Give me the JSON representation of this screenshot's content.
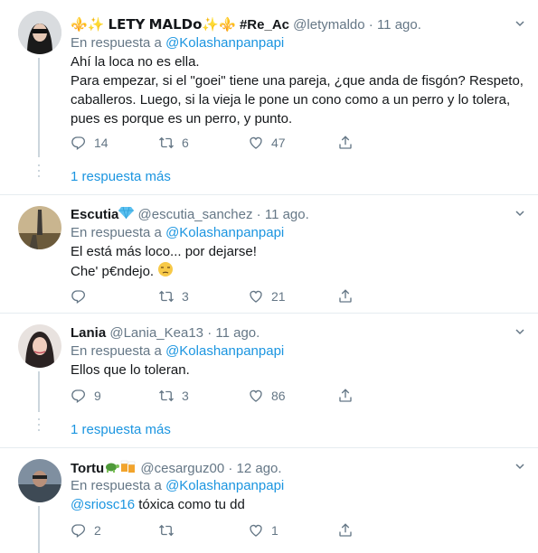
{
  "tweets": [
    {
      "name": "⚜️✨ 𝗟𝗘𝗧𝗬 𝗠𝗔𝗟𝗗𝗼✨⚜️ #Re_Ac",
      "handle": "@letymaldo",
      "dot": "·",
      "date": "11 ago.",
      "reply_prefix": "En respuesta a",
      "reply_to": "@Kolashanpanpapi",
      "lines": [
        "Ahí la loca no es ella.",
        "Para empezar, si el \"goei\" tiene una pareja, ¿que anda de fisgón? Respeto,",
        "caballeros. Luego, si la vieja le pone un cono como a un perro y lo tolera,",
        "pues es porque es un perro, y punto."
      ],
      "replies": "14",
      "retweets": "6",
      "likes": "47",
      "more_replies": "1 respuesta más"
    },
    {
      "name": "Escutia",
      "handle": "@escutia_sanchez",
      "dot": "·",
      "date": "11 ago.",
      "reply_prefix": "En respuesta a",
      "reply_to": "@Kolashanpanpapi",
      "lines": [
        "El está más loco... por dejarse!",
        "Che' p€ndejo."
      ],
      "replies": "",
      "retweets": "3",
      "likes": "21"
    },
    {
      "name": "Lania",
      "handle": "@Lania_Kea13",
      "dot": "·",
      "date": "11 ago.",
      "reply_prefix": "En respuesta a",
      "reply_to": "@Kolashanpanpapi",
      "lines": [
        "Ellos que lo toleran."
      ],
      "replies": "9",
      "retweets": "3",
      "likes": "86",
      "more_replies": "1 respuesta más"
    },
    {
      "name": "Tortu",
      "handle": "@cesarguz00",
      "dot": "·",
      "date": "12 ago.",
      "reply_prefix": "En respuesta a",
      "reply_to": "@Kolashanpanpapi",
      "mention": "@sriosc16",
      "lines": [
        "tóxica como tu dd"
      ],
      "replies": "2",
      "retweets": "",
      "likes": "1"
    }
  ],
  "colors": {
    "accent": "#1b95e0",
    "muted": "#657786",
    "border": "#e6ecf0",
    "text": "#14171a",
    "verified_gem": "#5bc0f0"
  }
}
